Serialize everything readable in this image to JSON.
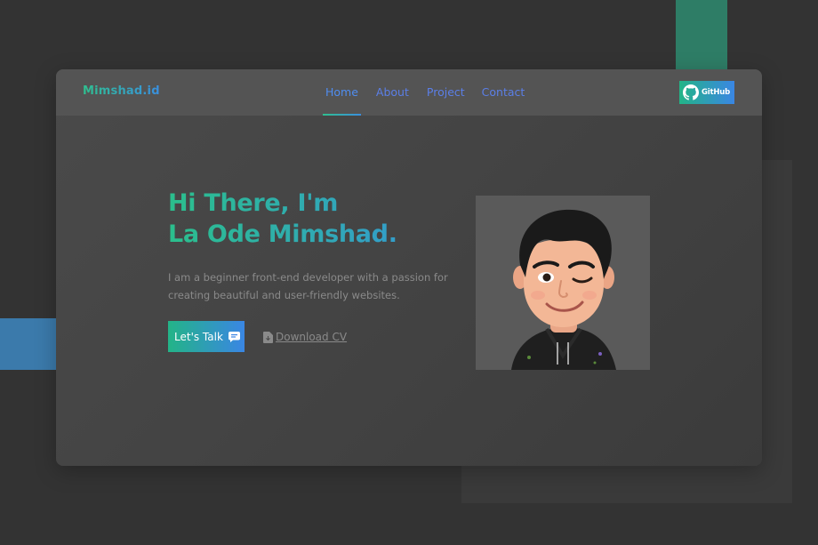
{
  "brand": {
    "name": "Mimshad.id"
  },
  "nav": {
    "items": [
      {
        "label": "Home",
        "active": true
      },
      {
        "label": "About",
        "active": false
      },
      {
        "label": "Project",
        "active": false
      },
      {
        "label": "Contact",
        "active": false
      }
    ]
  },
  "github_button": {
    "label": "GitHub",
    "icon": "github-icon"
  },
  "hero": {
    "title_line1": "Hi There, I'm",
    "title_line2": "La Ode Mimshad.",
    "description": "I am a beginner front-end developer with a passion for creating beautiful and user-friendly websites.",
    "cta_primary": {
      "label": "Let's Talk",
      "icon": "chat-icon"
    },
    "cta_secondary": {
      "label": "Download CV",
      "icon": "file-download-icon"
    }
  },
  "colors": {
    "accent_green": "#2bbf8c",
    "accent_blue": "#3a86e4",
    "nav_link": "#5b7fe8",
    "background": "#333333",
    "card": "#474747",
    "navbar": "#545454"
  }
}
